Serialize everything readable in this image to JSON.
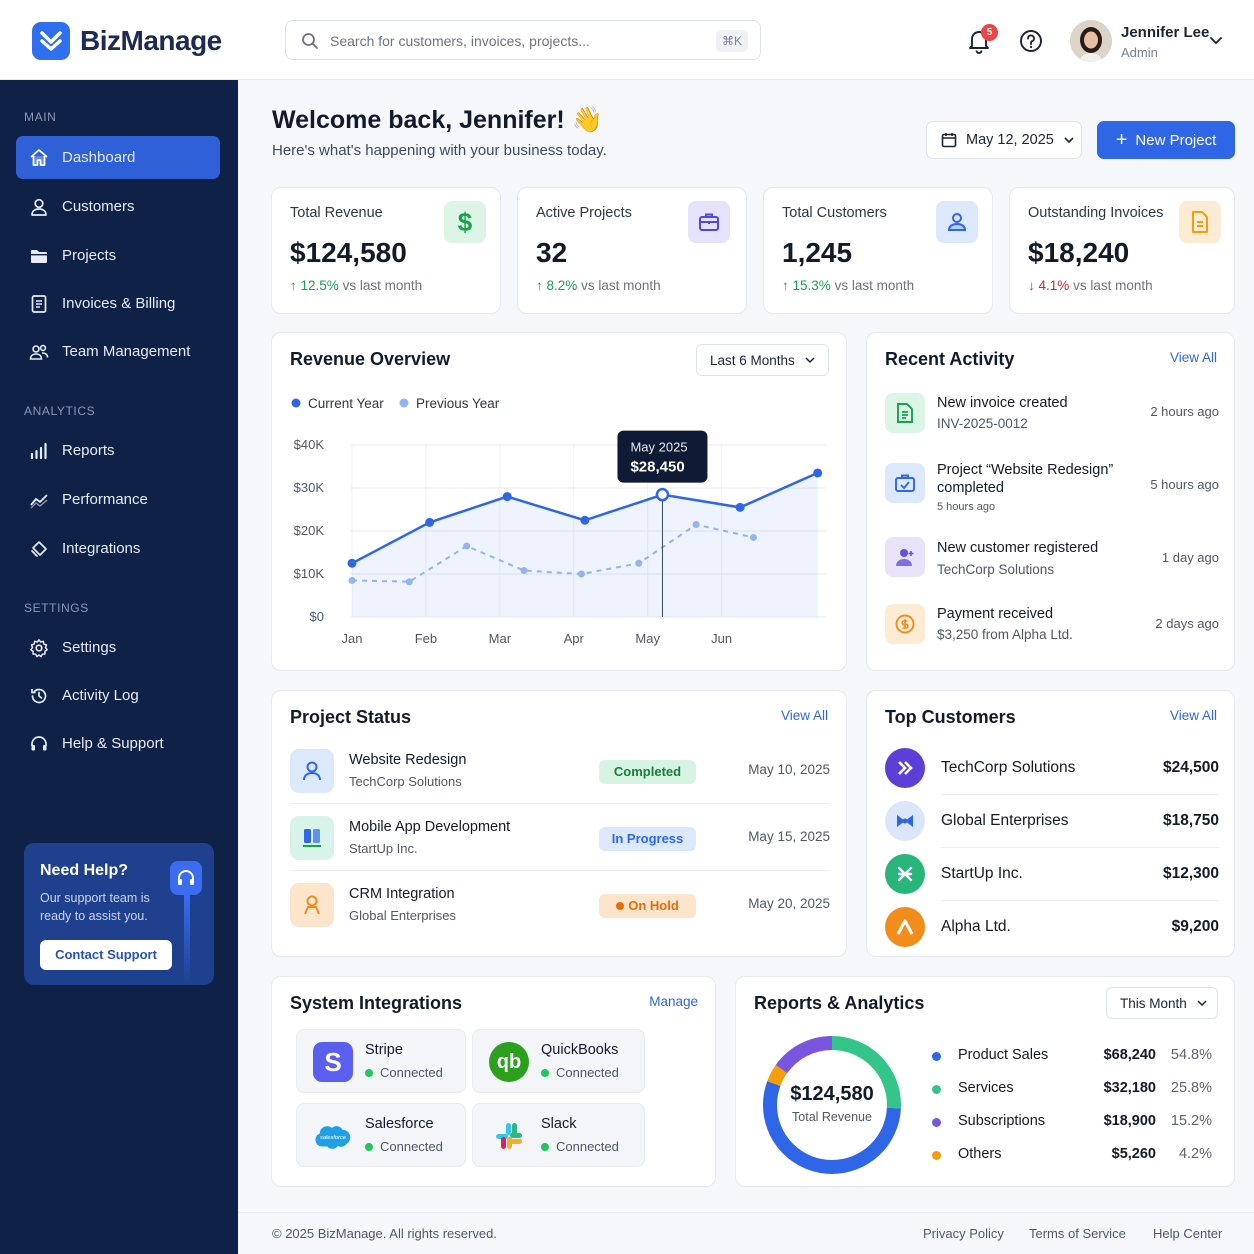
{
  "app": {
    "name": "BizManage"
  },
  "search": {
    "placeholder": "Search for customers, invoices, projects...",
    "shortcut": "⌘K"
  },
  "header": {
    "notifications_count": "5",
    "user_name": "Jennifer Lee",
    "user_role": "Admin"
  },
  "sidebar": {
    "sections": [
      "MAIN",
      "ANALYTICS",
      "SETTINGS"
    ],
    "items": [
      {
        "label": "Dashboard",
        "icon": "home-icon"
      },
      {
        "label": "Customers",
        "icon": "user-icon"
      },
      {
        "label": "Projects",
        "icon": "folder-icon"
      },
      {
        "label": "Invoices & Billing",
        "icon": "invoice-icon"
      },
      {
        "label": "Team Management",
        "icon": "team-icon"
      },
      {
        "label": "Reports",
        "icon": "bar-chart-icon"
      },
      {
        "label": "Performance",
        "icon": "trend-icon"
      },
      {
        "label": "Integrations",
        "icon": "puzzle-icon"
      },
      {
        "label": "Settings",
        "icon": "gear-icon"
      },
      {
        "label": "Activity Log",
        "icon": "history-icon"
      },
      {
        "label": "Help & Support",
        "icon": "headset-icon"
      }
    ],
    "help": {
      "title": "Need Help?",
      "text": "Our support team is ready to assist you.",
      "button": "Contact Support"
    }
  },
  "main": {
    "welcome": "Welcome back, Jennifer! 👋",
    "subtitle": "Here's what's happening with your business today.",
    "date": "May 12, 2025",
    "new_project": "New Project"
  },
  "stats": [
    {
      "label": "Total Revenue",
      "value": "$124,580",
      "change": "12.5%",
      "suffix": "vs last month",
      "dir": "up",
      "color": "#16a34a"
    },
    {
      "label": "Active Projects",
      "value": "32",
      "change": "8.2%",
      "suffix": "vs last month",
      "dir": "up",
      "color": "#4f46e5"
    },
    {
      "label": "Total Customers",
      "value": "1,245",
      "change": "15.3%",
      "suffix": "vs last month",
      "dir": "up",
      "color": "#2f66e8"
    },
    {
      "label": "Outstanding Invoices",
      "value": "$18,240",
      "change": "4.1%",
      "suffix": "vs last month",
      "dir": "down",
      "color": "#f59e0b"
    }
  ],
  "revenue": {
    "title": "Revenue Overview",
    "range": "Last 6 Months",
    "tooltip": {
      "label": "May 2025",
      "value": "$28,450"
    }
  },
  "chart_data": {
    "type": "line",
    "x": [
      "Jan",
      "Feb",
      "Mar",
      "Apr",
      "May",
      "Jun"
    ],
    "series": [
      {
        "name": "Current Year",
        "color": "#2f66e8",
        "values": [
          12500,
          22000,
          28000,
          22500,
          28450,
          25500,
          33500
        ]
      },
      {
        "name": "Previous Year",
        "color": "#93b4f3",
        "values": [
          8500,
          8200,
          16500,
          10800,
          10000,
          12500,
          21500,
          18500
        ]
      }
    ],
    "yticks": [
      "$0",
      "$10K",
      "$20K",
      "$30K",
      "$40K"
    ],
    "ylim": [
      0,
      40000
    ],
    "grid": true,
    "legend": "top-left"
  },
  "activity": {
    "title": "Recent Activity",
    "view_all": "View All",
    "items": [
      {
        "title": "New invoice created",
        "sub": "INV-2025-0012",
        "time": "2 hours ago"
      },
      {
        "title": "Project “Website Redesign” completed",
        "sub": "5 hours ago",
        "time": "5 hours ago"
      },
      {
        "title": "New customer registered",
        "sub": "TechCorp Solutions",
        "time": "1 day ago"
      },
      {
        "title": "Payment received",
        "sub": "$3,250 from Alpha Ltd.",
        "time": "2 days ago"
      }
    ]
  },
  "projects": {
    "title": "Project Status",
    "view_all": "View All",
    "items": [
      {
        "name": "Website Redesign",
        "client": "TechCorp Solutions",
        "status": "Completed",
        "date": "May 10, 2025"
      },
      {
        "name": "Mobile App Development",
        "client": "StartUp Inc.",
        "status": "In Progress",
        "date": "May 15, 2025"
      },
      {
        "name": "CRM Integration",
        "client": "Global Enterprises",
        "status": "On Hold",
        "date": "May 20, 2025"
      }
    ]
  },
  "customers": {
    "title": "Top Customers",
    "view_all": "View All",
    "items": [
      {
        "name": "TechCorp Solutions",
        "amount": "$24,500",
        "color": "#5b3fd6"
      },
      {
        "name": "Global Enterprises",
        "amount": "$18,750",
        "color": "#dbe6fb"
      },
      {
        "name": "StartUp Inc.",
        "amount": "$12,300",
        "color": "#27b57a"
      },
      {
        "name": "Alpha Ltd.",
        "amount": "$9,200",
        "color": "#f28c1b"
      }
    ]
  },
  "integrations": {
    "title": "System Integrations",
    "manage": "Manage",
    "items": [
      {
        "name": "Stripe",
        "status": "Connected"
      },
      {
        "name": "QuickBooks",
        "status": "Connected"
      },
      {
        "name": "Salesforce",
        "status": "Connected",
        "logo_text": "salesforce"
      },
      {
        "name": "Slack",
        "status": "Connected"
      }
    ]
  },
  "reports": {
    "title": "Reports & Analytics",
    "range": "This Month",
    "total": "$124,580",
    "total_label": "Total Revenue",
    "items": [
      {
        "name": "Product Sales",
        "value": "$68,240",
        "pct": "54.8%",
        "color": "#2f66e8"
      },
      {
        "name": "Services",
        "value": "$32,180",
        "pct": "25.8%",
        "color": "#34c58a"
      },
      {
        "name": "Subscriptions",
        "value": "$18,900",
        "pct": "15.2%",
        "color": "#7a55e0"
      },
      {
        "name": "Others",
        "value": "$5,260",
        "pct": "4.2%",
        "color": "#f59e0b"
      }
    ]
  },
  "footer": {
    "copyright": "© 2025 BizManage. All rights reserved.",
    "links": [
      "Privacy Policy",
      "Terms of Service",
      "Help Center"
    ]
  }
}
